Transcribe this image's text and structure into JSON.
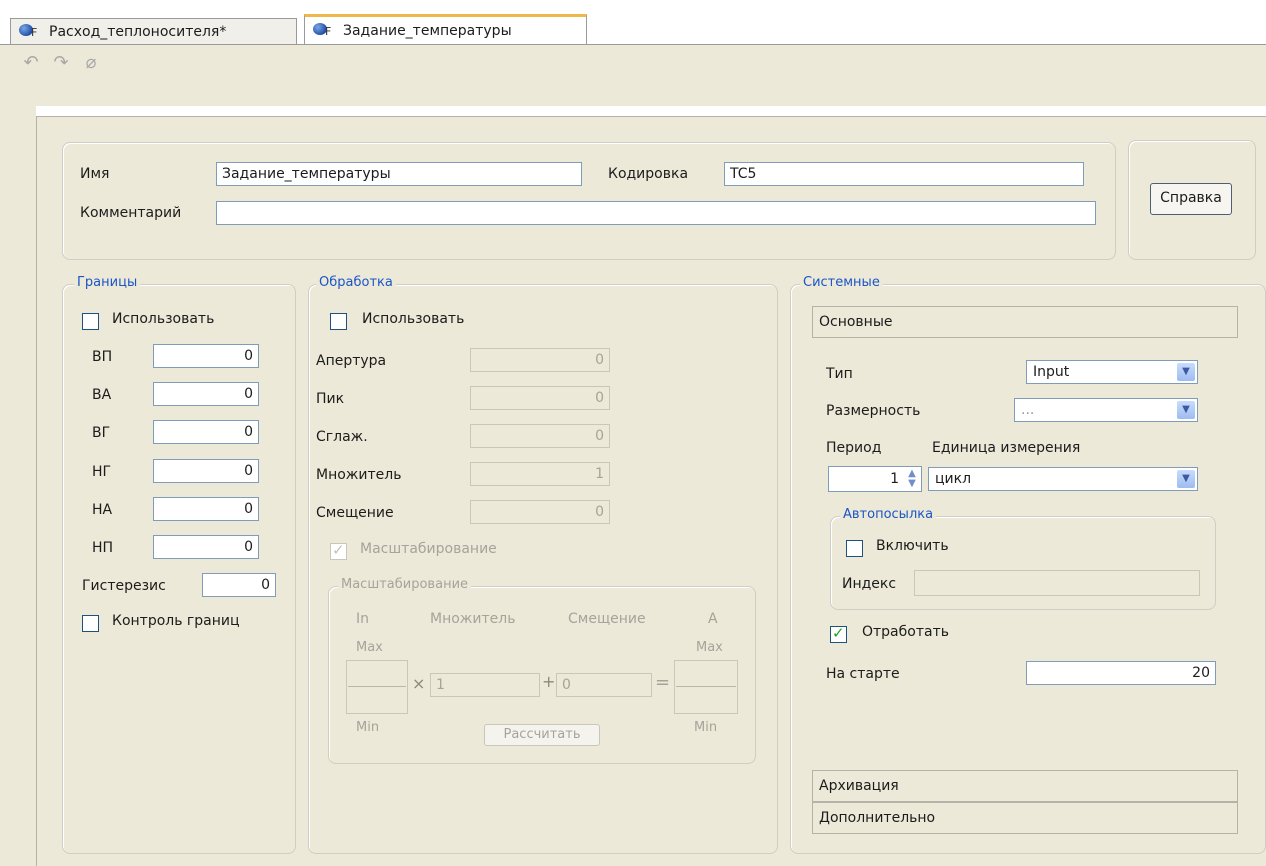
{
  "tabs": [
    {
      "label": "Расход_теплоносителя*",
      "active": false
    },
    {
      "label": "Задание_температуры",
      "active": true
    }
  ],
  "tab_icon_letter": "F",
  "toolbar": {
    "undo_icon": "undo-icon",
    "redo_icon": "redo-icon",
    "clear_icon": "eraser-icon"
  },
  "header": {
    "name_label": "Имя",
    "name_value": "Задание_температуры",
    "code_label": "Кодировка",
    "code_value": "TC5",
    "comment_label": "Комментарий",
    "comment_value": "",
    "help_button": "Справка"
  },
  "limits": {
    "title": "Границы",
    "use_label": "Использовать",
    "use_checked": false,
    "rows": [
      {
        "label": "ВП",
        "value": "0"
      },
      {
        "label": "ВА",
        "value": "0"
      },
      {
        "label": "ВГ",
        "value": "0"
      },
      {
        "label": "НГ",
        "value": "0"
      },
      {
        "label": "НА",
        "value": "0"
      },
      {
        "label": "НП",
        "value": "0"
      }
    ],
    "hysteresis_label": "Гистерезис",
    "hysteresis_value": "0",
    "control_label": "Контроль границ",
    "control_checked": false
  },
  "processing": {
    "title": "Обработка",
    "use_label": "Использовать",
    "use_checked": false,
    "rows": [
      {
        "label": "Апертура",
        "value": "0"
      },
      {
        "label": "Пик",
        "value": "0"
      },
      {
        "label": "Сглаж.",
        "value": "0"
      },
      {
        "label": "Множитель",
        "value": "1"
      },
      {
        "label": "Смещение",
        "value": "0"
      }
    ],
    "scaling_check_label": "Масштабирование",
    "scaling_checked": true,
    "scaling": {
      "title": "Масштабирование",
      "col_in": "In",
      "col_mult": "Множитель",
      "col_offset": "Смещение",
      "col_a": "A",
      "max_label": "Max",
      "min_label": "Min",
      "mult_value": "1",
      "offset_value": "0",
      "times_sign": "×",
      "plus_sign": "+",
      "eq_sign": "=",
      "calc_button": "Рассчитать"
    }
  },
  "system": {
    "title": "Системные",
    "section_main": "Основные",
    "type_label": "Тип",
    "type_value": "Input",
    "dimension_label": "Размерность",
    "dimension_value": "...",
    "period_label": "Период",
    "unit_label": "Единица измерения",
    "period_value": "1",
    "unit_value": "цикл",
    "autosend": {
      "title": "Автопосылка",
      "enable_label": "Включить",
      "enable_checked": false,
      "index_label": "Индекс",
      "index_value": ""
    },
    "process_label": "Отработать",
    "process_checked": true,
    "on_start_label": "На старте",
    "on_start_value": "20",
    "section_archive": "Архивация",
    "section_extra": "Дополнительно"
  }
}
